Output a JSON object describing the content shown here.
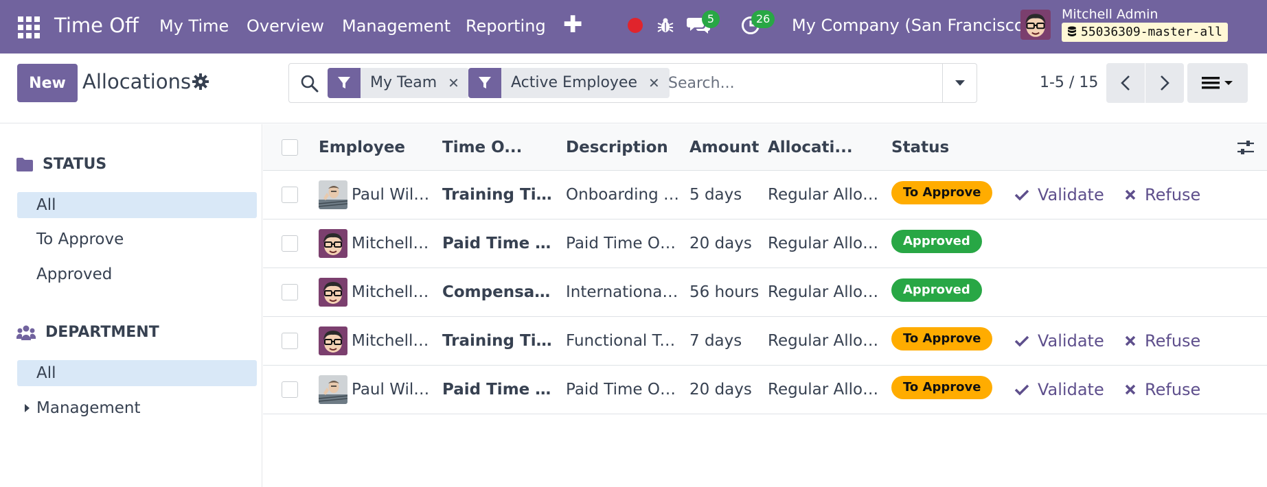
{
  "navbar": {
    "app_name": "Time Off",
    "menu": [
      "My Time",
      "Overview",
      "Management",
      "Reporting"
    ],
    "messages_count": "5",
    "activities_count": "26",
    "company": "My Company (San Francisco)",
    "user_name": "Mitchell Admin",
    "database": "55036309-master-all",
    "accent_color": "#71639e"
  },
  "control_panel": {
    "new_label": "New",
    "title": "Allocations",
    "search_placeholder": "Search...",
    "facets": [
      "My Team",
      "Active Employee"
    ],
    "pager": "1-5 / 15"
  },
  "sidebar": {
    "status_heading": "STATUS",
    "status_items": [
      "All",
      "To Approve",
      "Approved"
    ],
    "department_heading": "DEPARTMENT",
    "department_items": [
      "All",
      "Management"
    ]
  },
  "table": {
    "columns": [
      "Employee",
      "Time O...",
      "Description",
      "Amount",
      "Allocati...",
      "Status"
    ],
    "validate_label": "Validate",
    "refuse_label": "Refuse",
    "rows": [
      {
        "employee": "Paul Williams",
        "avatar": "paul-avatar",
        "time_off_type": "Training Time Off",
        "description": "Onboarding Training",
        "amount": "5 days",
        "allocation_type": "Regular Allocation",
        "status": "To Approve",
        "status_color": "#ffac00"
      },
      {
        "employee": "Mitchell Admin",
        "avatar": "mitchell-avatar",
        "time_off_type": "Paid Time Off",
        "description": "Paid Time Off Allocation",
        "amount": "20 days",
        "allocation_type": "Regular Allocation",
        "status": "Approved",
        "status_color": "#28a745"
      },
      {
        "employee": "Mitchell Admin",
        "avatar": "mitchell-avatar",
        "time_off_type": "Compensatory Days",
        "description": "International Conference",
        "amount": "56 hours",
        "allocation_type": "Regular Allocation",
        "status": "Approved",
        "status_color": "#28a745"
      },
      {
        "employee": "Mitchell Admin",
        "avatar": "mitchell-avatar",
        "time_off_type": "Training Time Off",
        "description": "Functional Training",
        "amount": "7 days",
        "allocation_type": "Regular Allocation",
        "status": "To Approve",
        "status_color": "#ffac00"
      },
      {
        "employee": "Paul Williams",
        "avatar": "paul-avatar",
        "time_off_type": "Paid Time Off",
        "description": "Paid Time Off Allocation",
        "amount": "20 days",
        "allocation_type": "Regular Allocation",
        "status": "To Approve",
        "status_color": "#ffac00"
      }
    ]
  }
}
